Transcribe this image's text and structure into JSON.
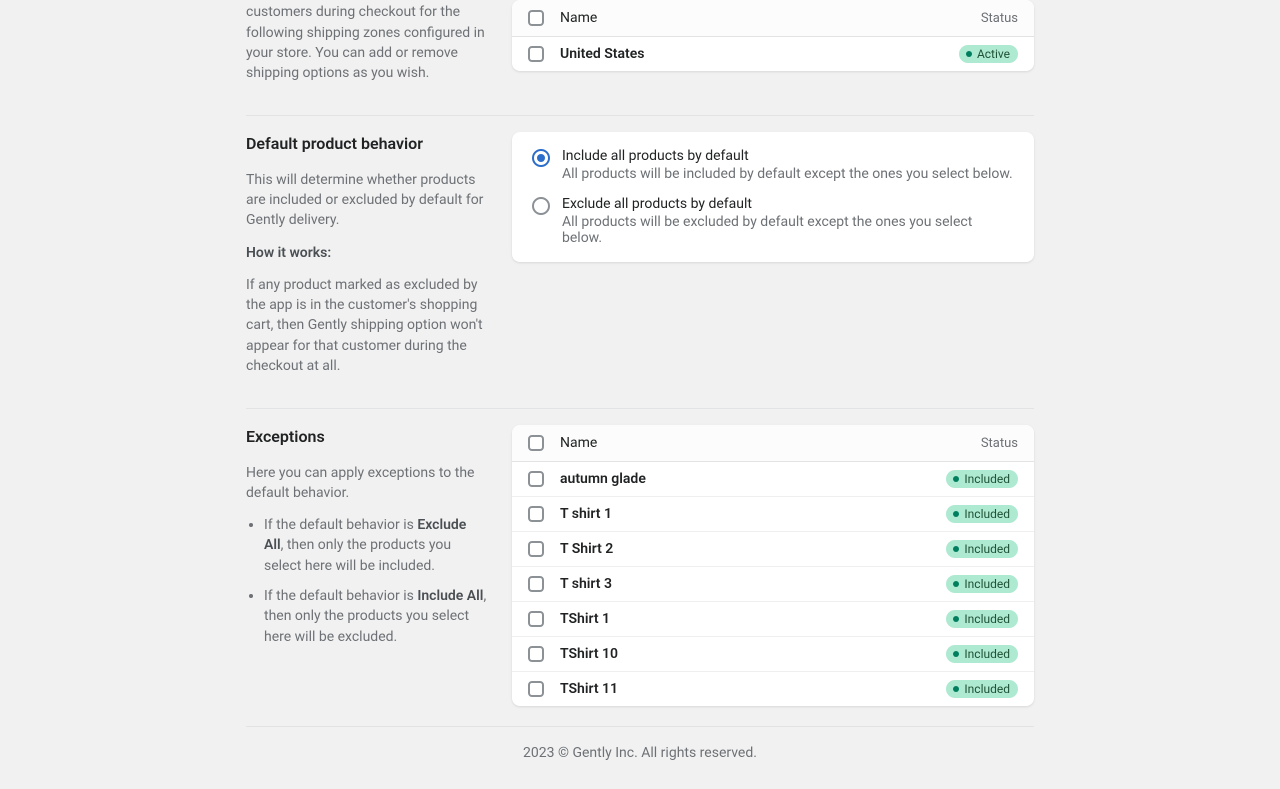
{
  "columns": {
    "name": "Name",
    "status": "Status"
  },
  "shipping_zones": {
    "description": "Gently shipping option will appear for customers during checkout for the following shipping zones configured in your store. You can add or remove shipping options as you wish.",
    "rows": [
      {
        "name": "United States",
        "status": "Active"
      }
    ]
  },
  "default_behavior": {
    "title": "Default product behavior",
    "desc": "This will determine whether products are included or excluded by default for Gently delivery.",
    "how_label": "How it works:",
    "how_body": "If any product marked as excluded by the app is in the customer's shopping cart, then Gently shipping option won't appear for that customer during the checkout at all.",
    "options": [
      {
        "label": "Include all products by default",
        "desc": "All products will be included by default except the ones you select below.",
        "checked": true
      },
      {
        "label": "Exclude all products by default",
        "desc": "All products will be excluded by default except the ones you select below.",
        "checked": false
      }
    ]
  },
  "exceptions": {
    "title": "Exceptions",
    "desc": "Here you can apply exceptions to the default behavior.",
    "bullet_prefix": "If the default behavior is ",
    "bullets": [
      {
        "strong": "Exclude All",
        "rest": ", then only the products you select here will be included."
      },
      {
        "strong": "Include All",
        "rest": ", then only the products you select here will be excluded."
      }
    ],
    "rows": [
      {
        "name": "autumn glade",
        "status": "Included"
      },
      {
        "name": "T shirt 1",
        "status": "Included"
      },
      {
        "name": "T Shirt 2",
        "status": "Included"
      },
      {
        "name": "T shirt 3",
        "status": "Included"
      },
      {
        "name": "TShirt 1",
        "status": "Included"
      },
      {
        "name": "TShirt 10",
        "status": "Included"
      },
      {
        "name": "TShirt 11",
        "status": "Included"
      }
    ]
  },
  "footer": "2023 © Gently Inc. All rights reserved."
}
